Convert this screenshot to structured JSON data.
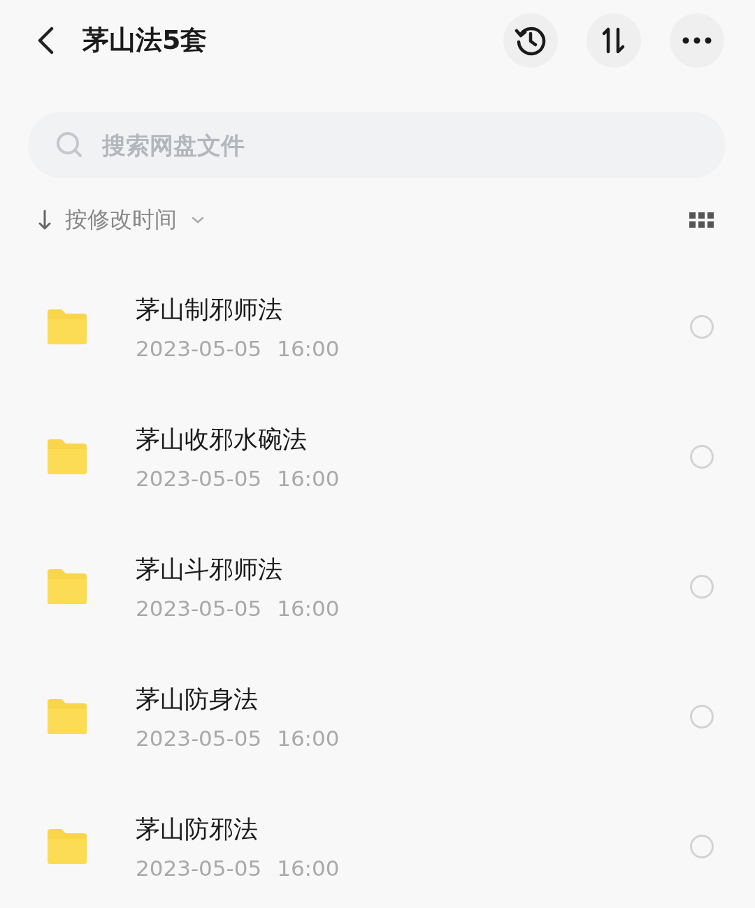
{
  "header": {
    "title": "茅山法5套"
  },
  "search": {
    "placeholder": "搜索网盘文件"
  },
  "sort": {
    "label": "按修改时间"
  },
  "files": [
    {
      "name": "茅山制邪师法",
      "date": "2023-05-05",
      "time": "16:00",
      "selected": false
    },
    {
      "name": "茅山收邪水碗法",
      "date": "2023-05-05",
      "time": "16:00",
      "selected": false
    },
    {
      "name": "茅山斗邪师法",
      "date": "2023-05-05",
      "time": "16:00",
      "selected": false
    },
    {
      "name": "茅山防身法",
      "date": "2023-05-05",
      "time": "16:00",
      "selected": false
    },
    {
      "name": "茅山防邪法",
      "date": "2023-05-05",
      "time": "16:00",
      "selected": false
    }
  ]
}
